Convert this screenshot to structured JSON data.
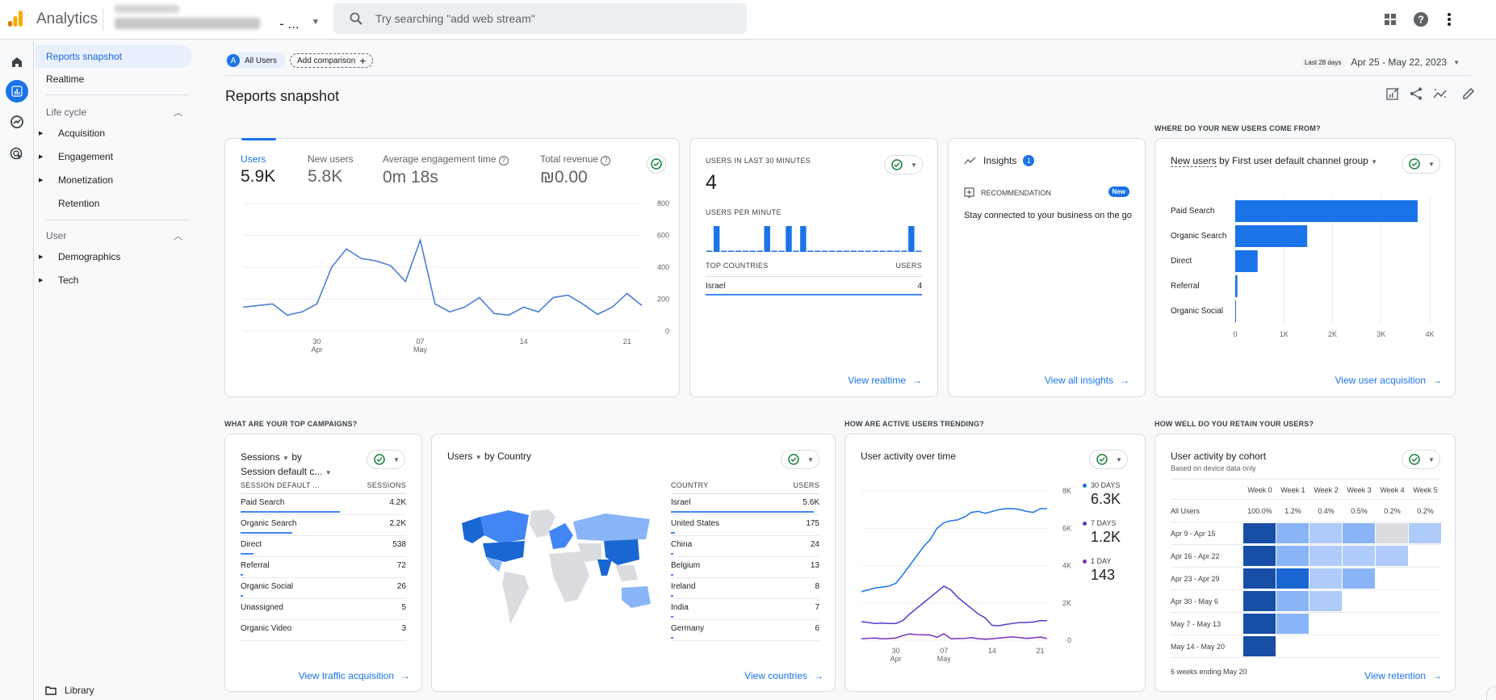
{
  "topbar": {
    "app_title": "Analytics",
    "property_suffix": "- ...",
    "search_placeholder": "Try searching \"add web stream\""
  },
  "nav": {
    "items": [
      {
        "label": "Reports snapshot",
        "active": true
      },
      {
        "label": "Realtime"
      }
    ],
    "sections": [
      {
        "label": "Life cycle",
        "children": [
          "Acquisition",
          "Engagement",
          "Monetization",
          "Retention"
        ]
      },
      {
        "label": "User",
        "children": [
          "Demographics",
          "Tech"
        ]
      }
    ],
    "library_label": "Library"
  },
  "comparison": {
    "segment_letter": "A",
    "segment_label": "All Users",
    "add_label": "Add comparison"
  },
  "date": {
    "preset": "Last 28 days",
    "range": "Apr 25 - May 22, 2023"
  },
  "page_title": "Reports snapshot",
  "overview": {
    "metrics": [
      {
        "label": "Users",
        "value": "5.9K",
        "active": true
      },
      {
        "label": "New users",
        "value": "5.8K"
      },
      {
        "label": "Average engagement time",
        "value": "0m 18s",
        "help": true
      },
      {
        "label": "Total revenue",
        "value": "₪0.00",
        "help": true
      }
    ]
  },
  "realtime": {
    "title": "USERS IN LAST 30 MINUTES",
    "value": "4",
    "per_minute_label": "USERS PER MINUTE",
    "countries_header": "TOP COUNTRIES",
    "users_header": "USERS",
    "countries": [
      {
        "name": "Israel",
        "value": "4"
      }
    ],
    "link": "View realtime"
  },
  "insights": {
    "title": "Insights",
    "count": "1",
    "rec_label": "RECOMMENDATION",
    "badge": "New",
    "text": "Stay connected to your business on the go",
    "link": "View all insights"
  },
  "acquisition": {
    "section_title": "WHERE DO YOUR NEW USERS COME FROM?",
    "metric": "New users",
    "by": "by First user default channel group",
    "link": "View user acquisition"
  },
  "campaigns": {
    "section_title": "WHAT ARE YOUR TOP CAMPAIGNS?",
    "metric": "Sessions",
    "by": "by",
    "dimension": "Session default c...",
    "col1": "SESSION DEFAULT ...",
    "col2": "SESSIONS",
    "rows": [
      {
        "name": "Paid Search",
        "value": "4.2K",
        "share": 1.0
      },
      {
        "name": "Organic Search",
        "value": "2.2K",
        "share": 0.52
      },
      {
        "name": "Direct",
        "value": "538",
        "share": 0.13
      },
      {
        "name": "Referral",
        "value": "72",
        "share": 0.02
      },
      {
        "name": "Organic Social",
        "value": "26",
        "share": 0.006
      },
      {
        "name": "Unassigned",
        "value": "5",
        "share": 0
      },
      {
        "name": "Organic Video",
        "value": "3",
        "share": 0
      }
    ],
    "link": "View traffic acquisition"
  },
  "countries": {
    "metric": "Users",
    "by": "by Country",
    "col1": "COUNTRY",
    "col2": "USERS",
    "rows": [
      {
        "name": "Israel",
        "value": "5.6K",
        "share": 1.0
      },
      {
        "name": "United States",
        "value": "175",
        "share": 0.03
      },
      {
        "name": "China",
        "value": "24",
        "share": 0.005
      },
      {
        "name": "Belgium",
        "value": "13",
        "share": 0.003
      },
      {
        "name": "Ireland",
        "value": "8",
        "share": 0.002
      },
      {
        "name": "India",
        "value": "7",
        "share": 0.001
      },
      {
        "name": "Germany",
        "value": "6",
        "share": 0.001
      }
    ],
    "link": "View countries"
  },
  "trending": {
    "section_title": "HOW ARE ACTIVE USERS TRENDING?",
    "title": "User activity over time",
    "legend": [
      {
        "label": "30 DAYS",
        "value": "6.3K",
        "color": "#1a73e8"
      },
      {
        "label": "7 DAYS",
        "value": "1.2K",
        "color": "#4b3fd1"
      },
      {
        "label": "1 DAY",
        "value": "143",
        "color": "#7b2fbf"
      }
    ]
  },
  "retention": {
    "section_title": "HOW WELL DO YOU RETAIN YOUR USERS?",
    "title": "User activity by cohort",
    "subtitle": "Based on device data only",
    "weeks": [
      "Week 0",
      "Week 1",
      "Week 2",
      "Week 3",
      "Week 4",
      "Week 5"
    ],
    "all_users_label": "All Users",
    "all_users": [
      "100.0%",
      "1.2%",
      "0.4%",
      "0.5%",
      "0.2%",
      "0.2%"
    ],
    "cohorts": [
      {
        "label": "Apr 9 - Apr 15",
        "levels": [
          4,
          2,
          1,
          2,
          0,
          1
        ]
      },
      {
        "label": "Apr 16 - Apr 22",
        "levels": [
          4,
          2,
          1,
          1,
          1
        ]
      },
      {
        "label": "Apr 23 - Apr 29",
        "levels": [
          4,
          3,
          1,
          2
        ]
      },
      {
        "label": "Apr 30 - May 6",
        "levels": [
          4,
          2,
          1
        ]
      },
      {
        "label": "May 7 - May 13",
        "levels": [
          4,
          2
        ]
      },
      {
        "label": "May 14 - May 20",
        "levels": [
          4
        ]
      }
    ],
    "footer": "6 weeks ending May 20",
    "link": "View retention"
  },
  "colors": {
    "accent": "#1a73e8",
    "success": "#188038"
  },
  "chart_data": [
    {
      "type": "line",
      "title": "Users",
      "x": [
        "Apr 25",
        "Apr 26",
        "Apr 27",
        "Apr 28",
        "Apr 29",
        "Apr 30",
        "May 1",
        "May 2",
        "May 3",
        "May 4",
        "May 5",
        "May 6",
        "May 7",
        "May 8",
        "May 9",
        "May 10",
        "May 11",
        "May 12",
        "May 13",
        "May 14",
        "May 15",
        "May 16",
        "May 17",
        "May 18",
        "May 19",
        "May 20",
        "May 21",
        "May 22"
      ],
      "values": [
        150,
        160,
        170,
        100,
        120,
        170,
        400,
        515,
        455,
        440,
        410,
        310,
        570,
        170,
        120,
        150,
        210,
        110,
        100,
        150,
        120,
        210,
        225,
        170,
        105,
        150,
        235,
        160
      ],
      "xticks": [
        "30 Apr",
        "07 May",
        "14",
        "21"
      ],
      "yticks": [
        0,
        200,
        400,
        600,
        800
      ],
      "ylim": [
        0,
        800
      ]
    },
    {
      "type": "bar",
      "title": "Users per minute",
      "values": [
        0,
        1,
        0,
        0,
        0,
        0,
        0,
        0,
        1,
        0,
        0,
        1,
        0,
        1,
        0,
        0,
        0,
        0,
        0,
        0,
        0,
        0,
        0,
        0,
        0,
        0,
        0,
        0,
        1,
        0
      ]
    },
    {
      "type": "bar",
      "title": "New users by First user default channel group",
      "categories": [
        "Paid Search",
        "Organic Search",
        "Direct",
        "Referral",
        "Organic Social"
      ],
      "values": [
        3750,
        1480,
        460,
        45,
        15
      ],
      "xticks": [
        "0",
        "1K",
        "2K",
        "3K",
        "4K"
      ],
      "xlim": [
        0,
        4000
      ]
    },
    {
      "type": "line",
      "title": "User activity over time",
      "x_count": 28,
      "series": [
        {
          "name": "30 DAYS",
          "values": [
            2600,
            2700,
            2800,
            2850,
            2900,
            3050,
            3500,
            4000,
            4500,
            5000,
            5400,
            6000,
            6300,
            6400,
            6450,
            6600,
            6850,
            6900,
            6800,
            6900,
            7000,
            7050,
            7050,
            7000,
            6900,
            6850,
            7050,
            7050
          ]
        },
        {
          "name": "7 DAYS",
          "values": [
            1000,
            950,
            900,
            920,
            900,
            900,
            1050,
            1400,
            1700,
            2000,
            2300,
            2600,
            2900,
            2700,
            2300,
            2000,
            1700,
            1400,
            1200,
            800,
            780,
            850,
            900,
            950,
            950,
            980,
            1050,
            1050
          ]
        },
        {
          "name": "1 DAY",
          "values": [
            80,
            100,
            120,
            80,
            90,
            120,
            250,
            340,
            300,
            290,
            280,
            160,
            350,
            80,
            90,
            100,
            140,
            80,
            60,
            80,
            120,
            150,
            180,
            140,
            100,
            130,
            170,
            90
          ]
        }
      ],
      "xticks": [
        "30 Apr",
        "07 May",
        "14",
        "21"
      ],
      "yticks": [
        "0",
        "2K",
        "4K",
        "6K",
        "8K"
      ],
      "ylim": [
        0,
        8000
      ]
    }
  ]
}
